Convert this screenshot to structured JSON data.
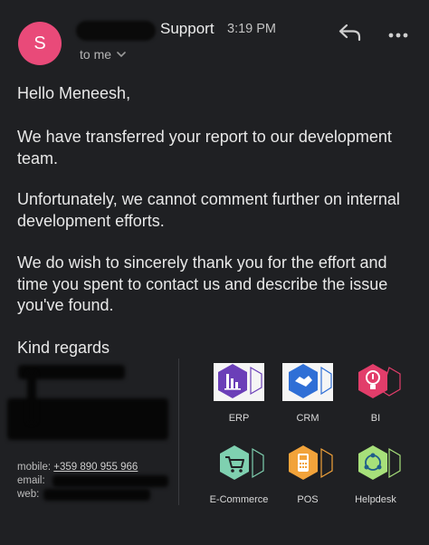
{
  "header": {
    "avatar_letter": "S",
    "sender_name": "Support",
    "time": "3:19 PM",
    "recipient": "to me"
  },
  "icons": {
    "reply": "reply-icon",
    "more": "more-horizontal-icon",
    "chevron": "chevron-down-icon"
  },
  "email": {
    "greeting": "Hello Meneesh,",
    "paragraph_1": "We have transferred your report to our development team.",
    "paragraph_2": "Unfortunately, we cannot comment further on internal development efforts.",
    "paragraph_3": "We do wish to sincerely thank you for the effort and time you spent to contact us and describe the issue you've found.",
    "closing": "Kind regards"
  },
  "signature": {
    "mobile_label": "mobile:",
    "mobile_value": "+359 890 955 966",
    "email_label": "email:",
    "web_label": "web:"
  },
  "modules": [
    {
      "label": "ERP",
      "icon": "erp-icon",
      "color": "#6b3fb8"
    },
    {
      "label": "CRM",
      "icon": "crm-icon",
      "color": "#2f6fd6"
    },
    {
      "label": "BI",
      "icon": "bi-icon",
      "color": "#e23d6a"
    },
    {
      "label": "E-Commerce",
      "icon": "ecommerce-icon",
      "color": "#7fd0b0"
    },
    {
      "label": "POS",
      "icon": "pos-icon",
      "color": "#f2a33a"
    },
    {
      "label": "Helpdesk",
      "icon": "helpdesk-icon",
      "color": "#a7e07a"
    }
  ],
  "colors": {
    "background": "#1f2023",
    "avatar": "#e94a79",
    "text": "#e8e8e8"
  }
}
